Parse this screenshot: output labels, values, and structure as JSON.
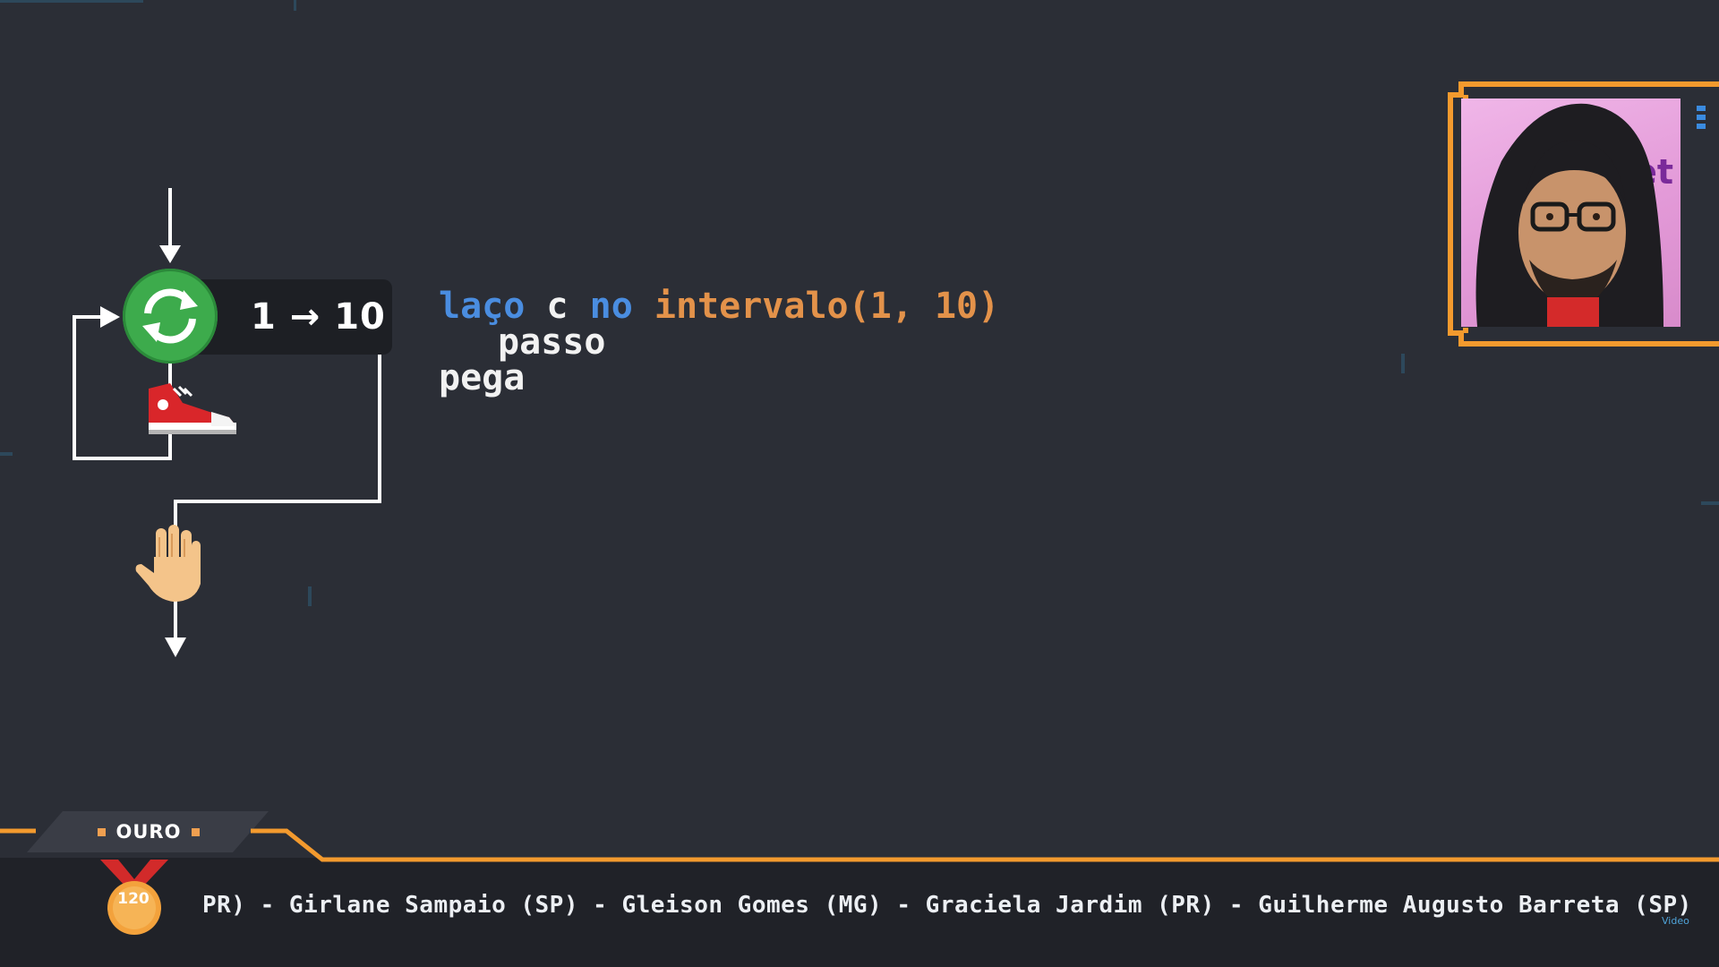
{
  "flowchart": {
    "range_label": "1 → 10",
    "loop_icon": "refresh-icon",
    "step_icon": "sneaker-icon",
    "stop_icon": "hand-icon"
  },
  "code": {
    "line1": {
      "kw1": "laço",
      "var": "c",
      "kw2": "no",
      "fn": "intervalo(1, 10)"
    },
    "line2": "passo",
    "line3": "pega"
  },
  "ticker": {
    "rank_label": "OURO",
    "medal_value": "120",
    "names": "PR) - Girlane Sampaio (SP) - Gleison Gomes (MG) - Graciela Jardim (PR) - Guilherme Augusto Barreta (SP)",
    "badge": "Video"
  },
  "webcam": {
    "overlay_text": "et"
  },
  "colors": {
    "background": "#2b2e36",
    "accent_orange": "#f39a2e",
    "keyword_blue": "#4a8de0",
    "function_orange": "#e3924a",
    "loop_green": "#3dab4c"
  }
}
